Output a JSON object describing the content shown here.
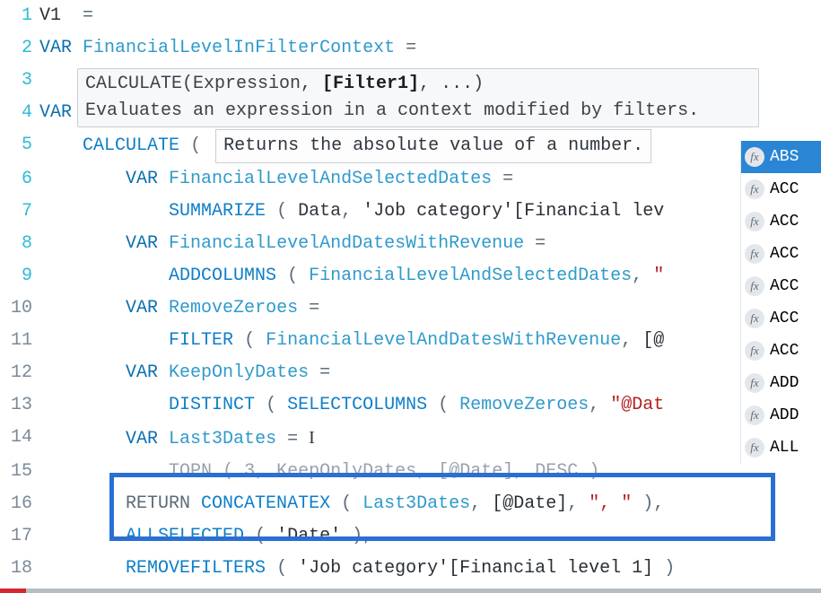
{
  "lines": {
    "l1": {
      "num": "1",
      "v1": "V1",
      "eq": "="
    },
    "l2": {
      "num": "2",
      "var": "VAR",
      "name": "FinancialLevelInFilterContext",
      "eq": "="
    },
    "l3": {
      "num": "3"
    },
    "l4": {
      "num": "4",
      "var": "VAR"
    },
    "l5": {
      "num": "5",
      "fn": "CALCULATE",
      "open": "(",
      "tip": "Returns the absolute value of a number."
    },
    "l6": {
      "num": "6",
      "var": "VAR",
      "name": "FinancialLevelAndSelectedDates",
      "eq": "="
    },
    "l7": {
      "num": "7",
      "fn": "SUMMARIZE",
      "open": "(",
      "arg1": "Data",
      "comma": ",",
      "arg2": "'Job category'[Financial lev"
    },
    "l8": {
      "num": "8",
      "var": "VAR",
      "name": "FinancialLevelAndDatesWithRevenue",
      "eq": "="
    },
    "l9": {
      "num": "9",
      "fn": "ADDCOLUMNS",
      "open": "(",
      "arg1": "FinancialLevelAndSelectedDates",
      "comma": ",",
      "arg2": "\""
    },
    "l10": {
      "num": "10",
      "var": "VAR",
      "name": "RemoveZeroes",
      "eq": "="
    },
    "l11": {
      "num": "11",
      "fn": "FILTER",
      "open": "(",
      "arg1": "FinancialLevelAndDatesWithRevenue",
      "comma": ",",
      "arg2": "[@"
    },
    "l12": {
      "num": "12",
      "var": "VAR",
      "name": "KeepOnlyDates",
      "eq": "="
    },
    "l13": {
      "num": "13",
      "fn1": "DISTINCT",
      "open1": "(",
      "fn2": "SELECTCOLUMNS",
      "open2": "(",
      "arg1": "RemoveZeroes",
      "comma": ",",
      "arg2": "\"@Dat"
    },
    "l14": {
      "num": "14",
      "var": "VAR",
      "name": "Last3Dates",
      "eq": "="
    },
    "l15": {
      "num": "15",
      "fn": "TOPN",
      "open": "(",
      "arg1": "3",
      "comma1": ",",
      "arg2": "KeepOnlyDates",
      "comma2": ",",
      "arg3": "[@Date]",
      "comma3": ",",
      "arg4": "DESC",
      "close": ")"
    },
    "l16": {
      "num": "16",
      "ret": "RETURN",
      "fn": "CONCATENATEX",
      "open": "(",
      "arg1": "Last3Dates",
      "comma1": ",",
      "arg2": "[@Date]",
      "comma2": ",",
      "arg3": "\", \"",
      "close": ")",
      "trail": ","
    },
    "l17": {
      "num": "17",
      "fn": "ALLSELECTED",
      "open": "(",
      "arg1": "'Date'",
      "close": ")",
      "trail": ","
    },
    "l18": {
      "num": "18",
      "fn": "REMOVEFILTERS",
      "open": "(",
      "arg1": "'Job category'[Financial level 1]",
      "close": ")"
    }
  },
  "tooltip": {
    "sig1": "CALCULATE(Expression, ",
    "sigbold": "[Filter1]",
    "sig2": ", ...)",
    "desc": "Evaluates an expression in a context modified by filters."
  },
  "intellisense": {
    "fx": "fx",
    "items": [
      "ABS",
      "ACC",
      "ACC",
      "ACC",
      "ACC",
      "ACC",
      "ACC",
      "ADD",
      "ADD",
      "ALL"
    ]
  }
}
